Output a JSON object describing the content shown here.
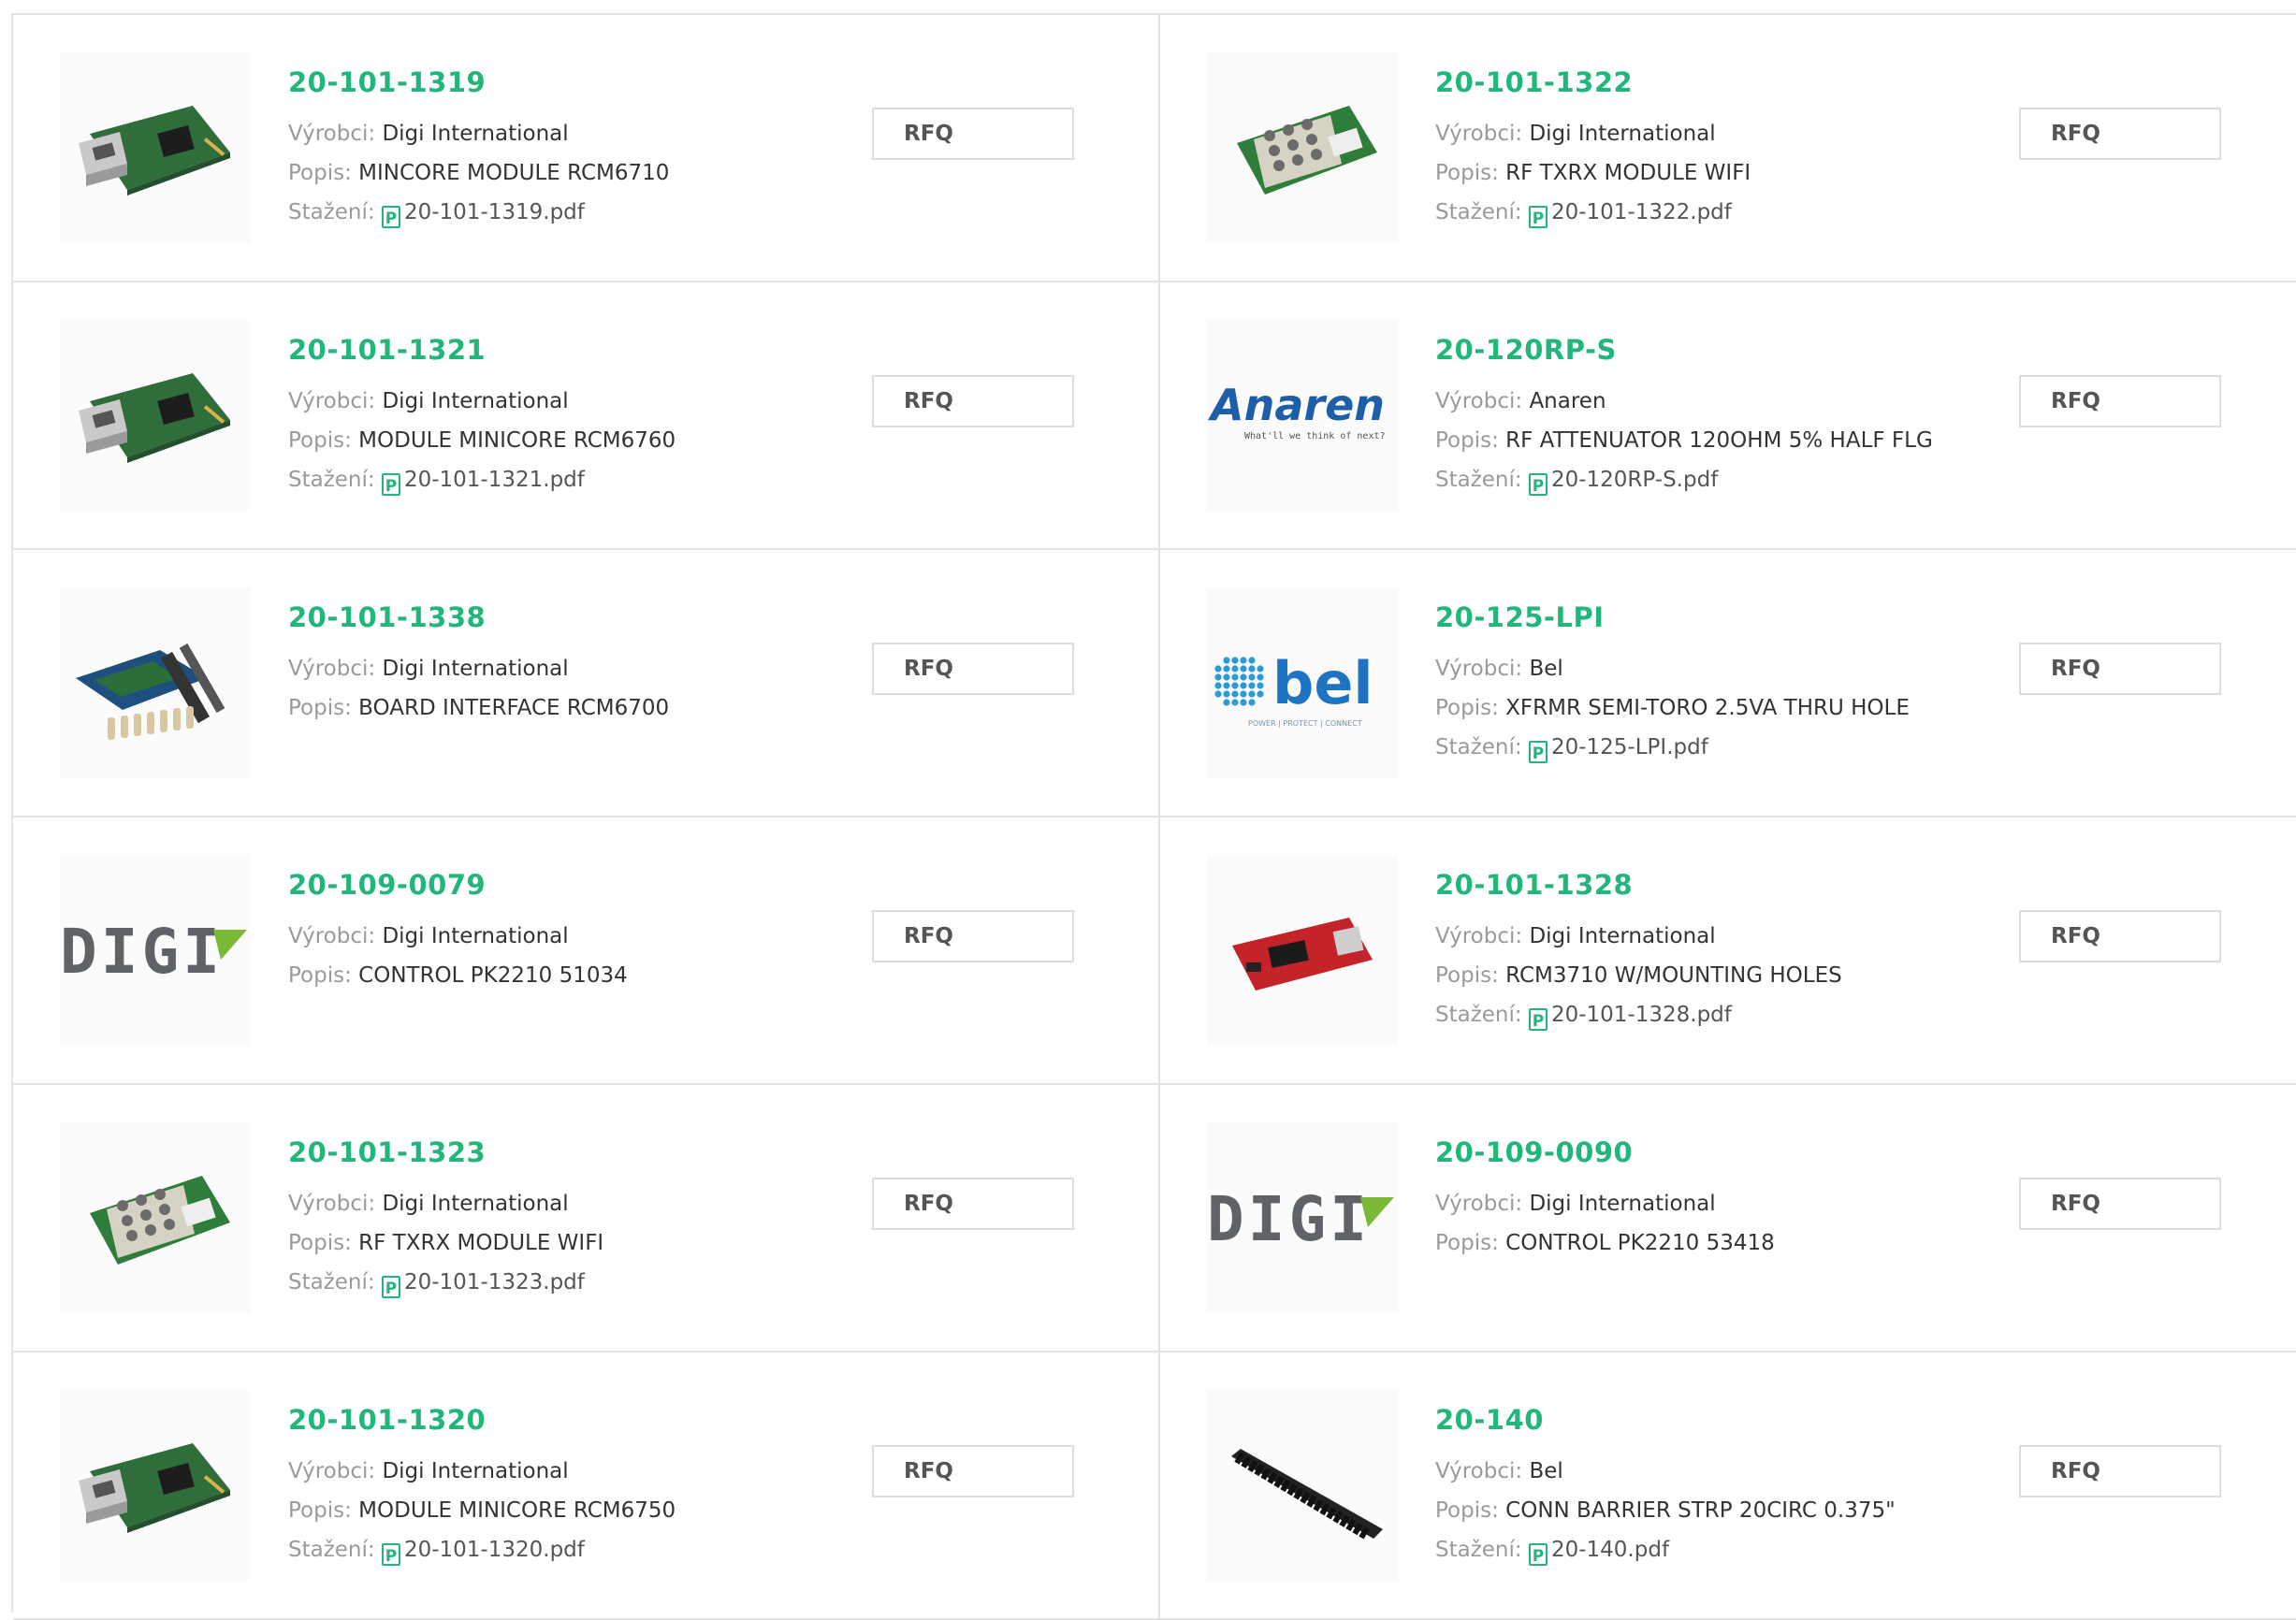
{
  "labels": {
    "manufacturer": "Výrobci:",
    "description": "Popis:",
    "download": "Stažení:",
    "rfq": "RFQ",
    "pdf_icon_glyph": "P"
  },
  "colors": {
    "accent": "#22b67a",
    "label": "#9a9a9a",
    "text": "#333333",
    "border": "#e3e3e3"
  },
  "products": [
    {
      "part": "20-101-1319",
      "manufacturer": "Digi International",
      "description": "MINCORE MODULE RCM6710",
      "pdf": "20-101-1319.pdf",
      "image": "module-ethernet-image"
    },
    {
      "part": "20-101-1322",
      "manufacturer": "Digi International",
      "description": "RF TXRX MODULE WIFI",
      "pdf": "20-101-1322.pdf",
      "image": "wifi-module-image"
    },
    {
      "part": "20-101-1321",
      "manufacturer": "Digi International",
      "description": "MODULE MINICORE RCM6760",
      "pdf": "20-101-1321.pdf",
      "image": "module-ethernet-image"
    },
    {
      "part": "20-120RP-S",
      "manufacturer": "Anaren",
      "description": "RF ATTENUATOR 120OHM 5% HALF FLG",
      "pdf": "20-120RP-S.pdf",
      "image": "anaren-logo"
    },
    {
      "part": "20-101-1338",
      "manufacturer": "Digi International",
      "description": "BOARD INTERFACE RCM6700",
      "pdf": null,
      "image": "interface-board-image"
    },
    {
      "part": "20-125-LPI",
      "manufacturer": "Bel",
      "description": "XFRMR SEMI-TORO 2.5VA THRU HOLE",
      "pdf": "20-125-LPI.pdf",
      "image": "bel-logo"
    },
    {
      "part": "20-109-0079",
      "manufacturer": "Digi International",
      "description": "CONTROL PK2210 51034",
      "pdf": null,
      "image": "digi-logo"
    },
    {
      "part": "20-101-1328",
      "manufacturer": "Digi International",
      "description": "RCM3710 W/MOUNTING HOLES",
      "pdf": "20-101-1328.pdf",
      "image": "red-module-image"
    },
    {
      "part": "20-101-1323",
      "manufacturer": "Digi International",
      "description": "RF TXRX MODULE WIFI",
      "pdf": "20-101-1323.pdf",
      "image": "wifi-module-image"
    },
    {
      "part": "20-109-0090",
      "manufacturer": "Digi International",
      "description": "CONTROL PK2210 53418",
      "pdf": null,
      "image": "digi-logo"
    },
    {
      "part": "20-101-1320",
      "manufacturer": "Digi International",
      "description": "MODULE MINICORE RCM6750",
      "pdf": "20-101-1320.pdf",
      "image": "module-ethernet-image"
    },
    {
      "part": "20-140",
      "manufacturer": "Bel",
      "description": "CONN BARRIER STRP 20CIRC 0.375\"",
      "pdf": "20-140.pdf",
      "image": "barrier-strip-image"
    }
  ],
  "logos": {
    "anaren": {
      "name": "Anaren",
      "tagline": "What'll we think of next?"
    },
    "bel": {
      "name": "bel",
      "tagline": "POWER | PROTECT | CONNECT"
    },
    "digi": {
      "name": "DIGI"
    }
  }
}
